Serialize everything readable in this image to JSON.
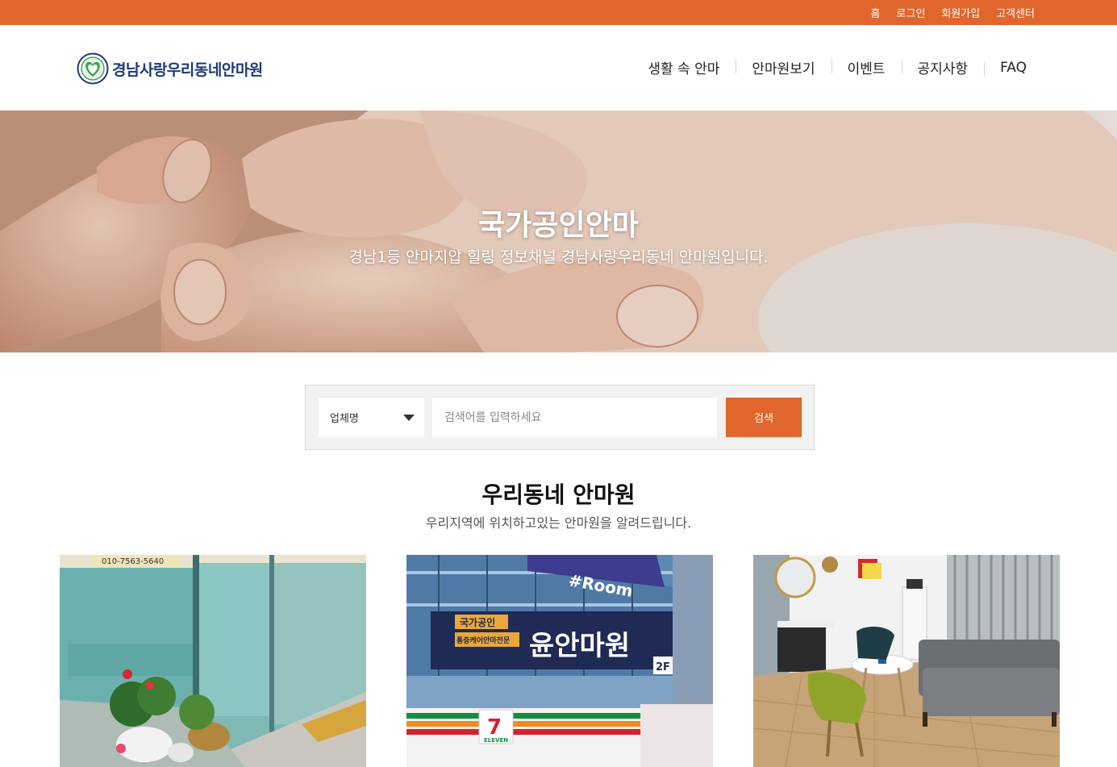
{
  "topbar": {
    "links": [
      "홈",
      "로그인",
      "회원가입",
      "고객센터"
    ],
    "color": "#e0662e"
  },
  "header": {
    "brand": "경남사랑우리동네안마원",
    "nav": [
      "생활 속 안마",
      "안마원보기",
      "이벤트",
      "공지사항",
      "FAQ"
    ]
  },
  "hero": {
    "title": "국가공인안마",
    "subtitle": "경남1등 안마지압 힐링 정보채널 경남사랑우리동네 안마원입니다."
  },
  "search": {
    "category": "업체명",
    "placeholder": "검색어를 입력하세요",
    "button": "검색"
  },
  "section": {
    "title": "우리동네 안마원",
    "description": "우리지역에 위치하고있는 안마원을 알려드립니다."
  },
  "cards": [
    {
      "sign": "010-7563-5640"
    },
    {
      "sign_main": "윤안마원",
      "sign_sub1": "국가공인",
      "sign_sub2": "통증케어안마전문",
      "sign_room": "#Room",
      "sign_floor": "2F",
      "store": "ELEVEN"
    },
    {
      "scene": "waiting-room"
    }
  ],
  "colors": {
    "accent": "#e0662e",
    "brand": "#1e3a78"
  }
}
